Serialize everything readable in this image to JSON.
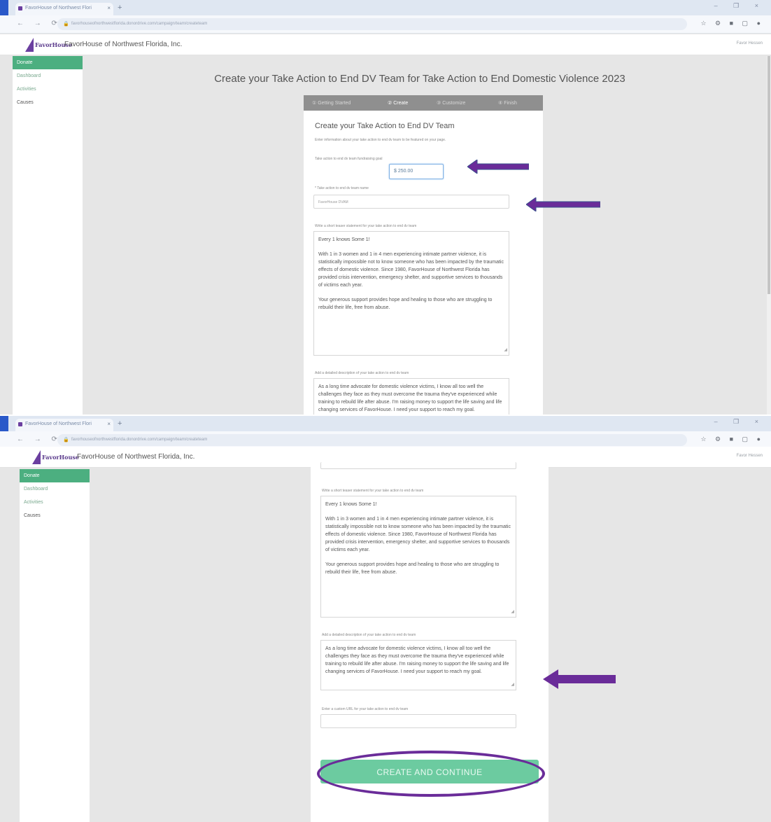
{
  "browser": {
    "tab_title": "FavorHouse of Northwest Flori",
    "tab_close": "×",
    "new_tab": "+",
    "window_controls": "–  ❐  ×",
    "nav_buttons": "← → ⟳",
    "url": "favorhouseofnorthwestflorida.donordrive.com/campaign/team/createteam",
    "ext_icons": "☆ ⚙ ■ ▢ ●"
  },
  "site": {
    "logo_text": "FavorHouse",
    "org_name": "FavorHouse of Northwest Florida, Inc.",
    "user_link_1": "Favor Hessen",
    "user_link_2": "Favor Hessen"
  },
  "sidebar": {
    "items": [
      {
        "label": "Donate"
      },
      {
        "label": "Dashboard"
      },
      {
        "label": "Activities"
      },
      {
        "label": "Causes"
      }
    ]
  },
  "page": {
    "title": "Create your Take Action to End DV Team for Take Action to End Domestic Violence 2023",
    "steps": [
      "① Getting Started",
      "② Create",
      "③ Customize",
      "④ Finish"
    ]
  },
  "form": {
    "heading": "Create your Take Action to End DV Team",
    "intro": "Enter information about your take action to end dv team to be featured on your page.",
    "goal_label": "Take action to end dv team fundraising goal",
    "goal_value": "$ 250.00",
    "name_label": "* Take action to end dv team name",
    "name_value": "FavorHouse DVAM",
    "short_label": "Write a short teaser statement for your take action to end dv team",
    "short_text_1": "Every 1 knows Some 1!",
    "short_text_2": "With 1 in 3 women and 1 in 4 men experiencing intimate partner violence, it is statistically impossible not to know someone who has been impacted by the traumatic effects of domestic violence. Since 1980, FavorHouse of Northwest Florida has provided crisis intervention, emergency shelter, and supportive services to thousands of victims each year.",
    "short_text_3": "Your generous support provides hope and healing to those who are struggling to rebuild their life, free from abuse.",
    "detail_label": "Add a detailed description of your take action to end dv team",
    "detail_text": "As a long time advocate for domestic violence victims, I know all too well the challenges they face as they must overcome the trauma they've experienced while training to rebuild life after abuse. I'm raising money to support the life saving and life changing services of FavorHouse. I need your support to reach my goal.",
    "url_label": "Enter a custom URL for your take action to end dv team",
    "submit": "CREATE AND CONTINUE",
    "grip": "◢"
  },
  "annotation_color": "#6a2c99"
}
